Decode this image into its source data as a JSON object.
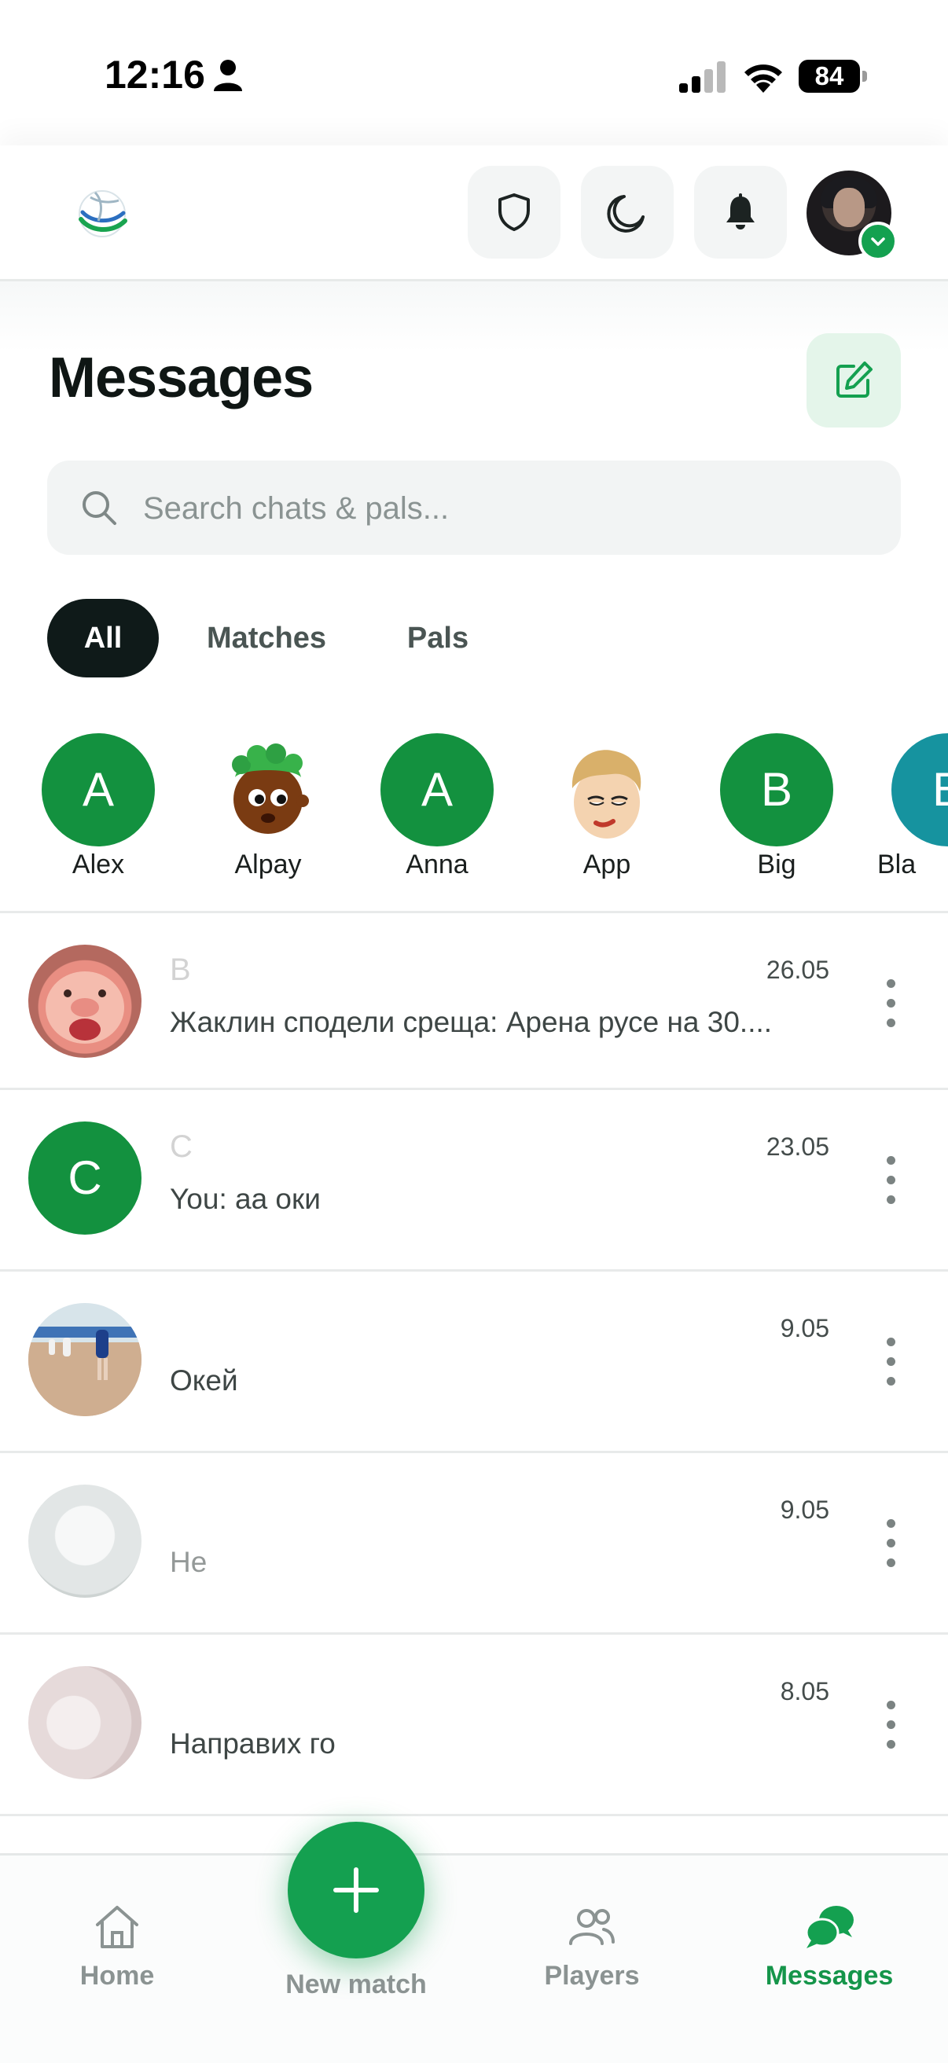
{
  "status_bar": {
    "time": "12:16",
    "battery": "84"
  },
  "header": {
    "icons": [
      "logo-icon",
      "shield-icon",
      "moon-icon",
      "bell-icon",
      "avatar"
    ]
  },
  "page": {
    "title": "Messages",
    "search_placeholder": "Search chats & pals..."
  },
  "filters": [
    {
      "label": "All",
      "active": true
    },
    {
      "label": "Matches",
      "active": false
    },
    {
      "label": "Pals",
      "active": false
    }
  ],
  "pals": [
    {
      "name": "Alex",
      "initial": "A",
      "color": "#13913f"
    },
    {
      "name": "Alpay",
      "initial": "",
      "color": ""
    },
    {
      "name": "Anna",
      "initial": "A",
      "color": "#13913f"
    },
    {
      "name": "App",
      "initial": "",
      "color": ""
    },
    {
      "name": "Big",
      "initial": "B",
      "color": "#13913f"
    },
    {
      "name": "Bla",
      "initial": "B",
      "color": "#16939f"
    }
  ],
  "chats": [
    {
      "name": "В",
      "date": "26.05",
      "preview": "Жаклин сподели среща: Арена русе на 30...."
    },
    {
      "name": "С",
      "date": "23.05",
      "preview": "You: аа оки",
      "initial": "C"
    },
    {
      "name": "",
      "date": "9.05",
      "preview": "Окей"
    },
    {
      "name": "",
      "date": "9.05",
      "preview": "Не"
    },
    {
      "name": "",
      "date": "8.05",
      "preview": "Направих го"
    }
  ],
  "nav": {
    "home": "Home",
    "new_match": "New match",
    "players": "Players",
    "messages": "Messages"
  },
  "colors": {
    "accent": "#14a050",
    "dark_pill": "#0f1a19",
    "compose_bg": "#e4f5ea"
  }
}
